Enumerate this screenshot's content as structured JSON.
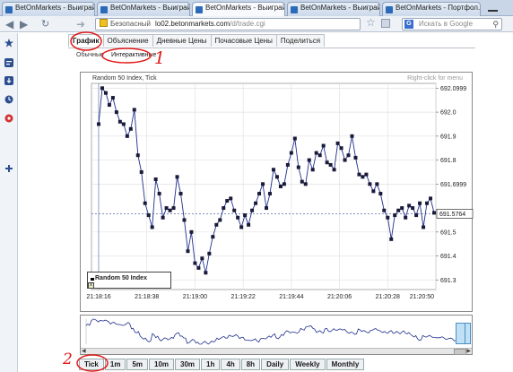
{
  "browser": {
    "tabs": [
      {
        "label": "BetOnMarkets - Выиграй..."
      },
      {
        "label": "BetOnMarkets - Выиграй..."
      },
      {
        "label": "BetOnMarkets - Выиграй..."
      },
      {
        "label": "BetOnMarkets - Выиграй..."
      },
      {
        "label": "BetOnMarkets - Портфол..."
      }
    ],
    "active_tab_index": 2,
    "address": {
      "security": "Безопасный",
      "host": "lo02.betonmarkets.com",
      "path": "/d/trade.cgi"
    },
    "search_placeholder": "Искать в Google"
  },
  "page": {
    "tabs": [
      "График",
      "Объяснение",
      "Дневные Цены",
      "Почасовые Цены",
      "Поделиться"
    ],
    "active_tab": "График",
    "sub_tabs": [
      "Обычные",
      "Интерактивные"
    ],
    "active_sub_tab": "Интерактивные",
    "intervals": [
      "Tick",
      "1m",
      "5m",
      "10m",
      "30m",
      "1h",
      "4h",
      "8h",
      "Daily",
      "Weekly",
      "Monthly"
    ],
    "selected_interval": "Tick"
  },
  "annotations": {
    "one": "1",
    "two": "2"
  },
  "colors": {
    "highlight": "#e21818",
    "series": "#1f2f8a",
    "current_price": "#5a6aa8",
    "marker": "#1a1a3a"
  },
  "chart_data": {
    "type": "line",
    "title": "Random 50 Index, Tick",
    "hint": "Right-click for menu",
    "legend": "Random 50 Index",
    "current_price": "691.5764",
    "current_price_value": 691.5764,
    "x_tick_labels": [
      "21:18:16",
      "21:18:38",
      "21:19:00",
      "21:19:22",
      "21:19:44",
      "21:20:06",
      "21:20:28",
      "21:20:50"
    ],
    "y_tick_labels": [
      "692.0999",
      "692.0",
      "691.9",
      "691.8",
      "691.6999",
      "691.5",
      "691.4",
      "691.3"
    ],
    "y_tick_values": [
      692.0999,
      692.0,
      691.9,
      691.8,
      691.6999,
      691.5,
      691.4,
      691.3
    ],
    "ylim": [
      691.26,
      692.12
    ],
    "grid": true,
    "series": [
      {
        "name": "Random 50 Index",
        "values": [
          691.95,
          692.1,
          692.08,
          692.03,
          692.06,
          692.0,
          691.96,
          691.95,
          691.9,
          691.93,
          692.01,
          691.82,
          691.75,
          691.62,
          691.57,
          691.52,
          691.72,
          691.66,
          691.56,
          691.6,
          691.59,
          691.6,
          691.73,
          691.66,
          691.55,
          691.42,
          691.5,
          691.37,
          691.35,
          691.39,
          691.33,
          691.41,
          691.48,
          691.53,
          691.55,
          691.6,
          691.63,
          691.64,
          691.59,
          691.56,
          691.52,
          691.57,
          691.53,
          691.59,
          691.62,
          691.66,
          691.7,
          691.6,
          691.66,
          691.76,
          691.73,
          691.69,
          691.7,
          691.78,
          691.83,
          691.89,
          691.77,
          691.71,
          691.7,
          691.8,
          691.76,
          691.83,
          691.82,
          691.86,
          691.79,
          691.78,
          691.76,
          691.87,
          691.85,
          691.8,
          691.82,
          691.9,
          691.81,
          691.74,
          691.73,
          691.74,
          691.7,
          691.67,
          691.7,
          691.66,
          691.59,
          691.56,
          691.47,
          691.57,
          691.59,
          691.6,
          691.56,
          691.61,
          691.6,
          691.57,
          691.62,
          691.52,
          691.62,
          691.64,
          691.58
        ]
      }
    ]
  }
}
